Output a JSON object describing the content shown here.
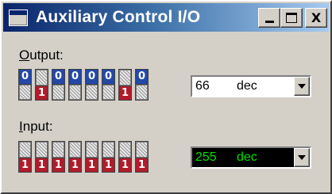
{
  "window": {
    "title": "Auxiliary Control I/O",
    "buttons": {
      "minimize": "_",
      "maximize": "□",
      "close": "X"
    }
  },
  "output": {
    "label_prefix": "O",
    "label_rest": "utput:",
    "bits": [
      "0",
      "1",
      "0",
      "0",
      "0",
      "0",
      "1",
      "0"
    ],
    "value": "66",
    "format": "dec"
  },
  "input": {
    "label_prefix": "I",
    "label_rest": "nput:",
    "bits": [
      "1",
      "1",
      "1",
      "1",
      "1",
      "1",
      "1",
      "1"
    ],
    "value": "255",
    "format": "dec"
  },
  "colors": {
    "bit_zero": "#2348a8",
    "bit_one": "#b01c2c",
    "input_display_bg": "#000000",
    "input_display_text": "#00e000"
  }
}
